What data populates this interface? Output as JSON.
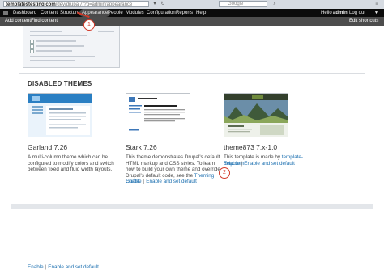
{
  "browser": {
    "url_host": "templatestesting.com",
    "url_path": "/dev/drupal7/?q=admin/appearance",
    "search_placeholder": "Google"
  },
  "toolbar": {
    "items": [
      "Dashboard",
      "Content",
      "Structure",
      "Appearance",
      "People",
      "Modules",
      "Configuration",
      "Reports",
      "Help"
    ],
    "active": "Appearance",
    "greeting": "Hello",
    "username": "admin",
    "logout": "Log out"
  },
  "shortcuts": {
    "add_content": "Add content",
    "find_content": "Find content",
    "edit_shortcuts": "Edit shortcuts"
  },
  "section_title": "DISABLED THEMES",
  "themes": [
    {
      "name": "Garland 7.26",
      "description": "A multi-column theme which can be configured to modify colors and switch between fixed and fluid width layouts.",
      "link_enable": "Enable",
      "link_default": "Enable and set default"
    },
    {
      "name": "Stark 7.26",
      "description": "This theme demonstrates Drupal's default HTML markup and CSS styles. To learn how to build your own theme and override Drupal's default code, see the",
      "desc_link": "Theming Guide",
      "desc_end": ".",
      "link_enable": "Enable",
      "link_default": "Enable and set default"
    },
    {
      "name": "theme873 7.x-1.0",
      "description": "This template is made by",
      "desc_link": "template-help.com",
      "link_enable": "Enable",
      "link_default": "Enable and set default"
    }
  ],
  "callouts": [
    "1",
    "2"
  ],
  "colors": {
    "toolbar_bg": "#0b0b0b",
    "shortcuts_bg": "#4d4d4d",
    "link": "#1b6fb0",
    "callout": "#d23a2a"
  }
}
